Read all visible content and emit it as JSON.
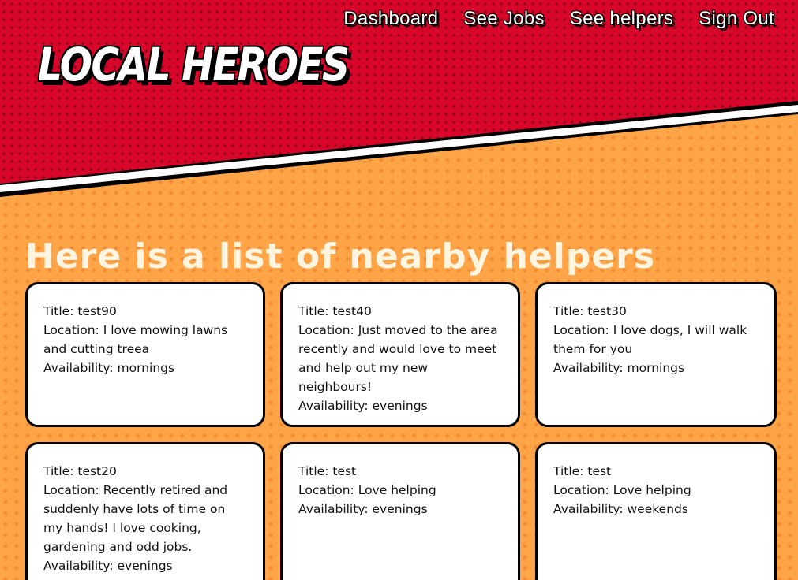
{
  "app": {
    "logo": "LOCAL HEROES"
  },
  "nav": {
    "items": [
      {
        "label": "Dashboard"
      },
      {
        "label": "See Jobs"
      },
      {
        "label": "See helpers"
      },
      {
        "label": "Sign Out"
      }
    ]
  },
  "main": {
    "heading": "Here is a list of nearby helpers",
    "helpers": [
      {
        "title": "Title: test90",
        "location": "Location: I love mowing lawns and cutting treea",
        "availability": "Availability: mornings"
      },
      {
        "title": "Title: test40",
        "location": "Location: Just moved to the area recently and would love to meet and help out my new neighbours!",
        "availability": "Availability: evenings"
      },
      {
        "title": "Title: test30",
        "location": "Location: I love dogs, I will walk them for you",
        "availability": "Availability: mornings"
      },
      {
        "title": "Title: test20",
        "location": "Location: Recently retired and suddenly have lots of time on my hands! I love cooking, gardening and odd jobs.",
        "availability": "Availability: evenings"
      },
      {
        "title": "Title: test",
        "location": "Location: Love helping",
        "availability": "Availability: evenings"
      },
      {
        "title": "Title: test",
        "location": "Location: Love helping",
        "availability": "Availability: weekends"
      }
    ]
  },
  "colors": {
    "header_red": "#d8062a",
    "background_orange": "#ffa447",
    "heading_cream": "#fff5e1",
    "card_bg": "#ffffff"
  }
}
